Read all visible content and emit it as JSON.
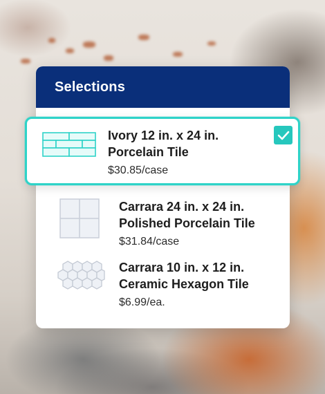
{
  "panel": {
    "title": "Selections"
  },
  "items": [
    {
      "name_line1": "Ivory 12 in. x 24 in.",
      "name_line2": "Porcelain Tile",
      "price": "$30.85/case",
      "icon": "brick-tile-icon",
      "selected": true
    },
    {
      "name_line1": "Carrara 24 in. x 24 in.",
      "name_line2": "Polished Porcelain Tile",
      "price": "$31.84/case",
      "icon": "square-tile-icon",
      "selected": false
    },
    {
      "name_line1": "Carrara 10 in. x 12 in.",
      "name_line2": "Ceramic Hexagon Tile",
      "price": "$6.99/ea.",
      "icon": "hexagon-tile-icon",
      "selected": false
    }
  ],
  "colors": {
    "header": "#0a2f7a",
    "accent": "#2ed3c8"
  }
}
